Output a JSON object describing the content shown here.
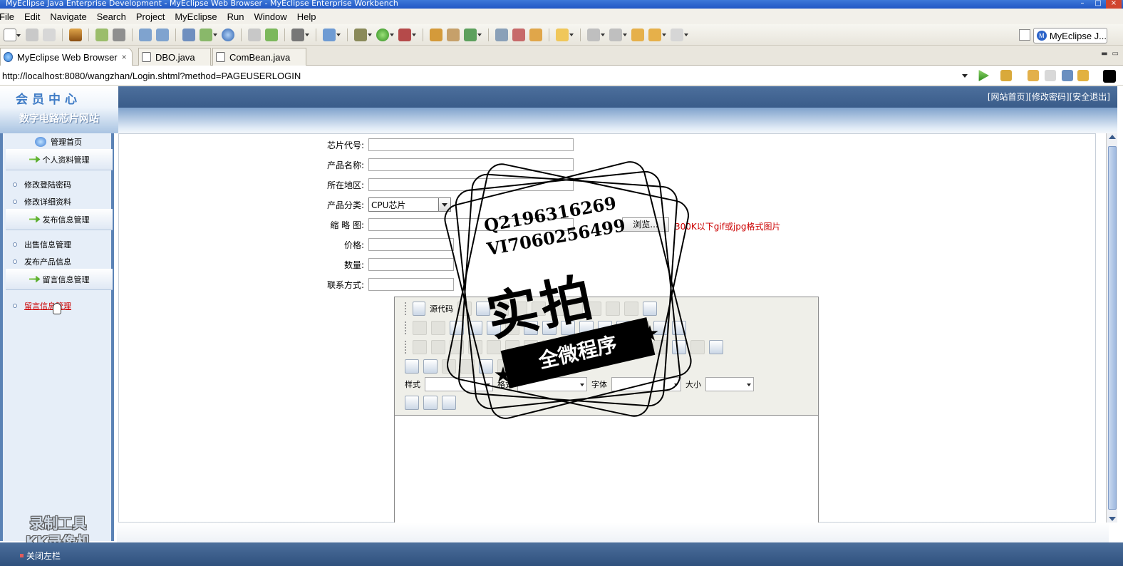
{
  "window": {
    "title": "MyEclipse Java Enterprise Development - MyEclipse Web Browser - MyEclipse Enterprise Workbench",
    "controls": [
      "–",
      "□",
      "×"
    ]
  },
  "menu": [
    "File",
    "Edit",
    "Navigate",
    "Search",
    "Project",
    "MyEclipse",
    "Run",
    "Window",
    "Help"
  ],
  "toolbar": {
    "perspective_label": "MyEclipse J...",
    "icons": [
      "new-icon",
      "save-icon",
      "print-icon",
      "package-icon",
      "debug-icon",
      "server-icon",
      "deploy-icon",
      "run-icon",
      "search-icon",
      "globe-icon",
      "folder-icon",
      "back-icon",
      "forward-icon"
    ]
  },
  "tabs": [
    {
      "label": "MyEclipse Web Browser",
      "close": "×",
      "active": true
    },
    {
      "label": "DBO.java",
      "active": false
    },
    {
      "label": "ComBean.java",
      "active": false
    }
  ],
  "address": {
    "url": "http://localhost:8080/wangzhan/Login.shtml?method=PAGEUSERLOGIN"
  },
  "site": {
    "logo_title": "会员中心",
    "logo_subtitle": "数字电路芯片网站",
    "top_links": [
      "[网站首页]",
      "[修改密码]",
      "[安全退出]"
    ],
    "bottom_close": "关闭左栏",
    "recorder_watermark_line1": "录制工具",
    "recorder_watermark_line2": "KK录像机"
  },
  "leftnav": {
    "home": "管理首页",
    "sections": [
      {
        "title": "个人资料管理",
        "items": [
          "修改登陆密码",
          "修改详细资料"
        ]
      },
      {
        "title": "发布信息管理",
        "items": [
          "出售信息管理",
          "发布产品信息"
        ]
      },
      {
        "title": "留言信息管理",
        "items": [
          "留言信息管理"
        ]
      }
    ]
  },
  "form": {
    "chip_code_label": "芯片代号:",
    "product_name_label": "产品名称:",
    "region_label": "所在地区:",
    "category_label": "产品分类:",
    "category_value": "CPU芯片",
    "thumbnail_label": "缩 略 图:",
    "browse_label": "浏览...",
    "thumbnail_hint": "300K以下gif或jpg格式图片",
    "price_label": "价格:",
    "quantity_label": "数量:",
    "contact_label": "联系方式:"
  },
  "editor": {
    "source_label": "源代码",
    "style_label": "样式",
    "format_label": "格式",
    "font_label": "字体",
    "size_label": "大小"
  },
  "stamp": {
    "line1": "Q2196316269",
    "line2": "VI7060256499",
    "big": "实拍",
    "ribbon": "全微程序"
  }
}
